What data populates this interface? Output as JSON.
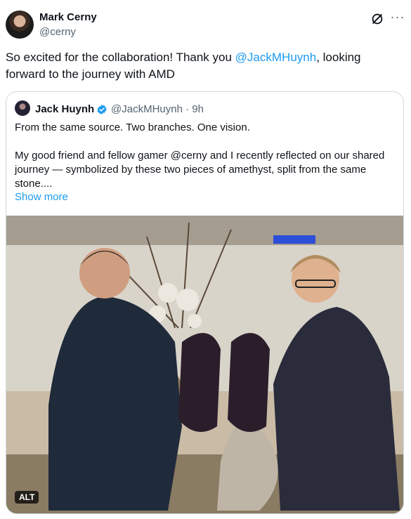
{
  "author": {
    "name": "Mark Cerny",
    "handle": "@cerny"
  },
  "tweet": {
    "text_before": "So excited for the collaboration! Thank you ",
    "mention": "@JackMHuynh",
    "text_after": ", looking forward to the journey with AMD"
  },
  "quote": {
    "name": "Jack Huynh",
    "handle": "@JackMHuynh",
    "time": "9h",
    "paragraph1": "From the same source.  Two branches.  One vision.",
    "paragraph2": "My good friend and fellow gamer @cerny and I recently reflected on our shared journey — symbolized by these two pieces of amethyst, split from the same stone....",
    "show_more": "Show more",
    "alt_label": "ALT"
  },
  "colors": {
    "link": "#1d9bf0",
    "verified": "#1d9bf0",
    "secondary_text": "#536471"
  },
  "icons": {
    "grok": "grok-icon",
    "more": "more-icon",
    "verified": "verified-badge-icon"
  }
}
